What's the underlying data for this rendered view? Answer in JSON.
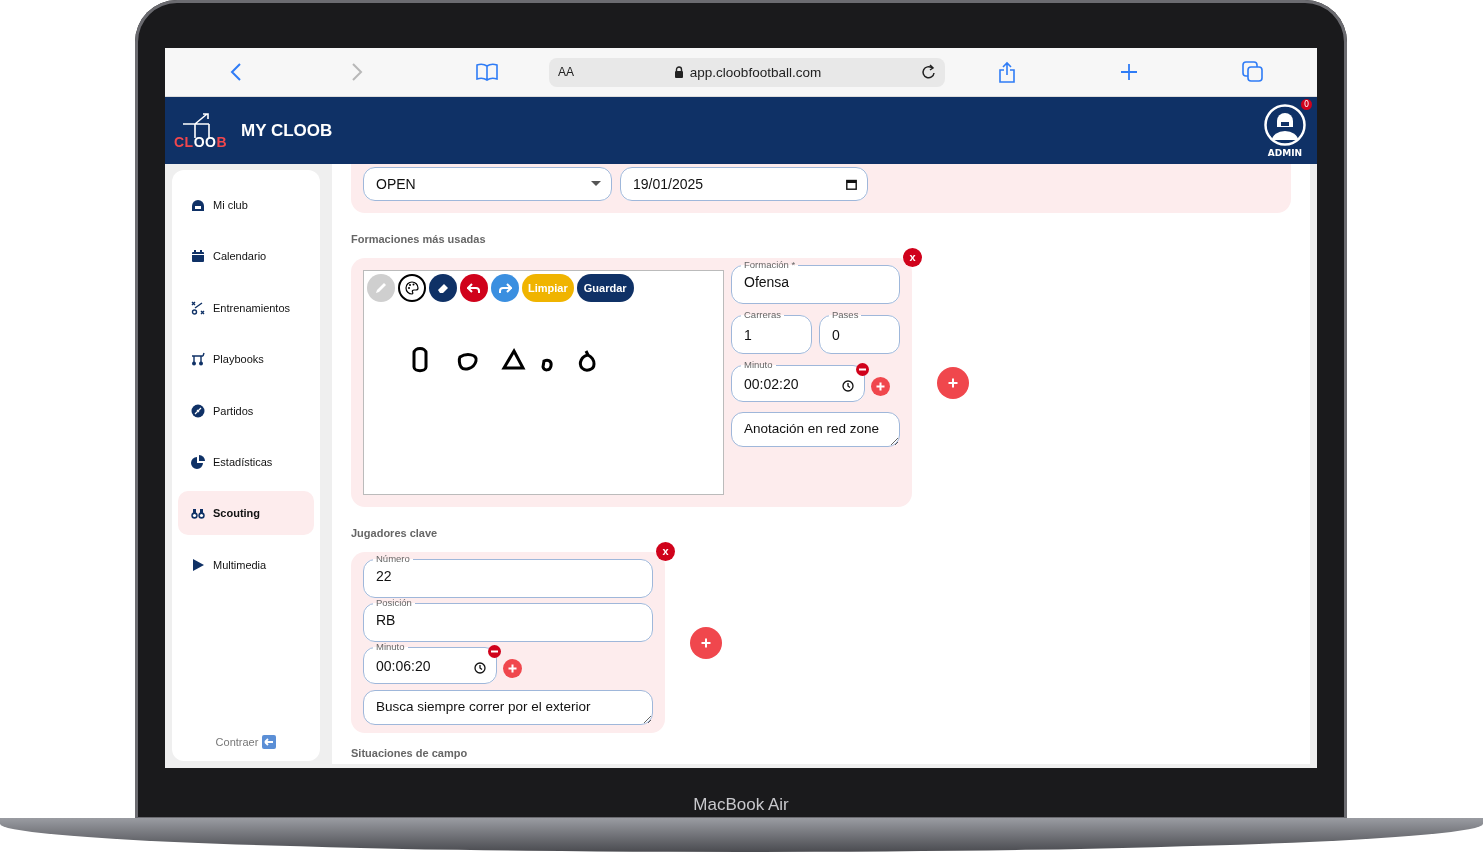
{
  "device": {
    "model": "MacBook Air"
  },
  "browser": {
    "reader": "AA",
    "url": "app.cloobfootball.com"
  },
  "header": {
    "logo": [
      {
        "text": "CL",
        "accent": true
      },
      {
        "text": "OO",
        "accent": false
      },
      {
        "text": "B",
        "accent": true
      }
    ],
    "title": "MY CLOOB",
    "user": {
      "role": "ADMIN",
      "badge": "0"
    }
  },
  "sidebar": {
    "items": [
      {
        "label": "Mi club",
        "selected": false
      },
      {
        "label": "Calendario",
        "selected": false
      },
      {
        "label": "Entrenamientos",
        "selected": false
      },
      {
        "label": "Playbooks",
        "selected": false
      },
      {
        "label": "Partidos",
        "selected": false
      },
      {
        "label": "Estadísticas",
        "selected": false
      },
      {
        "label": "Scouting",
        "selected": true
      },
      {
        "label": "Multimedia",
        "selected": false
      }
    ],
    "collapse": "Contraer"
  },
  "top_card": {
    "status": "OPEN",
    "date": "19/01/2025"
  },
  "formations": {
    "title": "Formaciones más usadas",
    "cards": [
      {
        "close": "x",
        "tools": [
          {
            "kind": "pencil",
            "disabled": true
          },
          {
            "kind": "palette",
            "disabled": false
          },
          {
            "kind": "eraser",
            "disabled": false
          },
          {
            "kind": "undo",
            "disabled": false
          },
          {
            "kind": "redo",
            "disabled": false
          },
          {
            "kind": "clear",
            "label": "Limpiar",
            "disabled": false
          },
          {
            "kind": "save",
            "label": "Guardar",
            "disabled": false
          }
        ],
        "formation": {
          "label": "Formación *",
          "value": "Ofensa"
        },
        "runs": {
          "label": "Carreras",
          "value": "1"
        },
        "passes": {
          "label": "Pases",
          "value": "0"
        },
        "minute": {
          "label": "Minuto",
          "value": "00:02:20"
        },
        "note": "Anotación en red zone"
      }
    ]
  },
  "players": {
    "title": "Jugadores clave",
    "cards": [
      {
        "close": "x",
        "number": {
          "label": "Número",
          "value": "22"
        },
        "position": {
          "label": "Posición",
          "value": "RB"
        },
        "minute": {
          "label": "Minuto",
          "value": "00:06:20"
        },
        "note": "Busca siempre correr por el exterior"
      }
    ]
  },
  "situations": {
    "title": "Situaciones de campo"
  }
}
